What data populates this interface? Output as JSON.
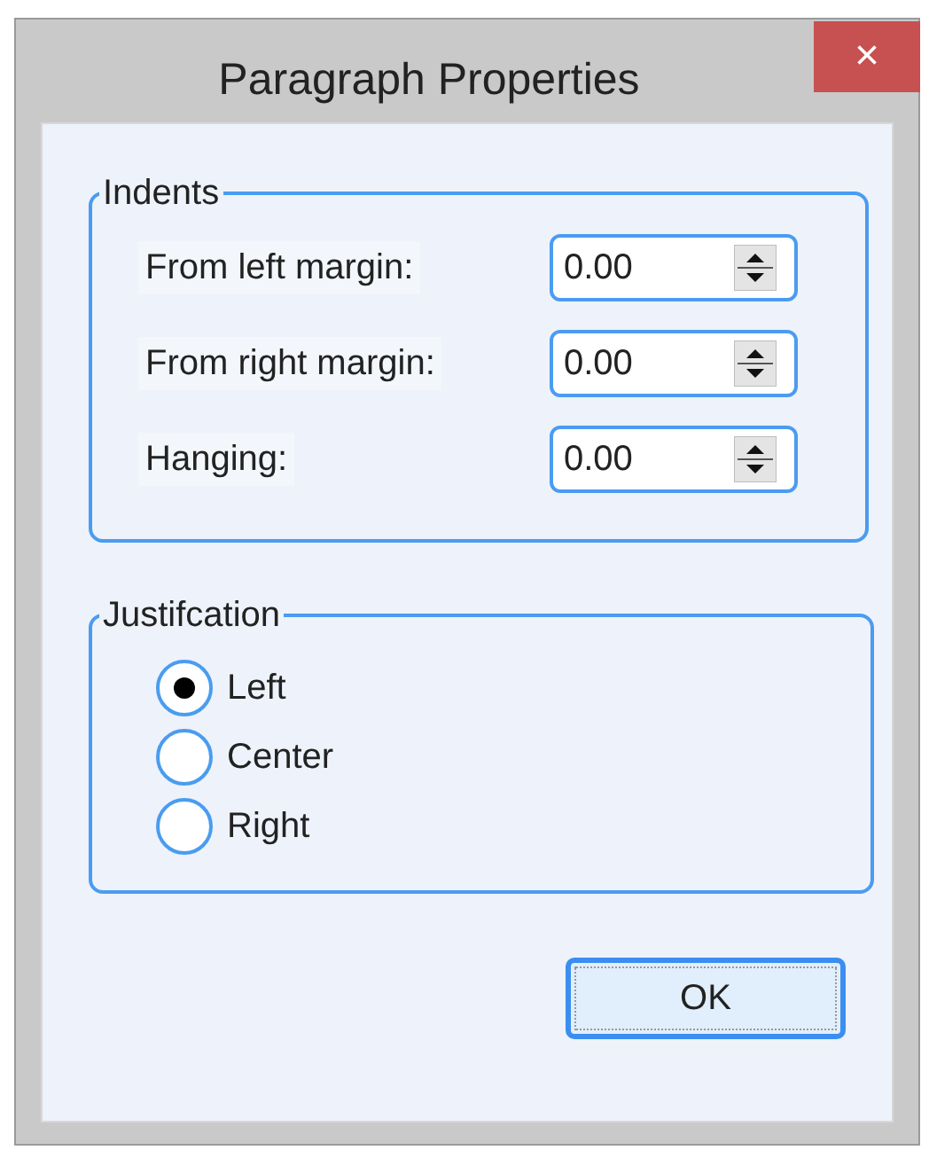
{
  "window": {
    "title": "Paragraph Properties",
    "close": "×"
  },
  "indents": {
    "title": "Indents",
    "fields": [
      {
        "label": "From left margin:",
        "value": "0.00"
      },
      {
        "label": "From right margin:",
        "value": "0.00"
      },
      {
        "label": "Hanging:",
        "value": "0.00"
      }
    ]
  },
  "justification": {
    "title": "Justifcation",
    "options": [
      {
        "label": "Left",
        "selected": true
      },
      {
        "label": "Center",
        "selected": false
      },
      {
        "label": "Right",
        "selected": false
      }
    ]
  },
  "buttons": [
    "OK"
  ]
}
